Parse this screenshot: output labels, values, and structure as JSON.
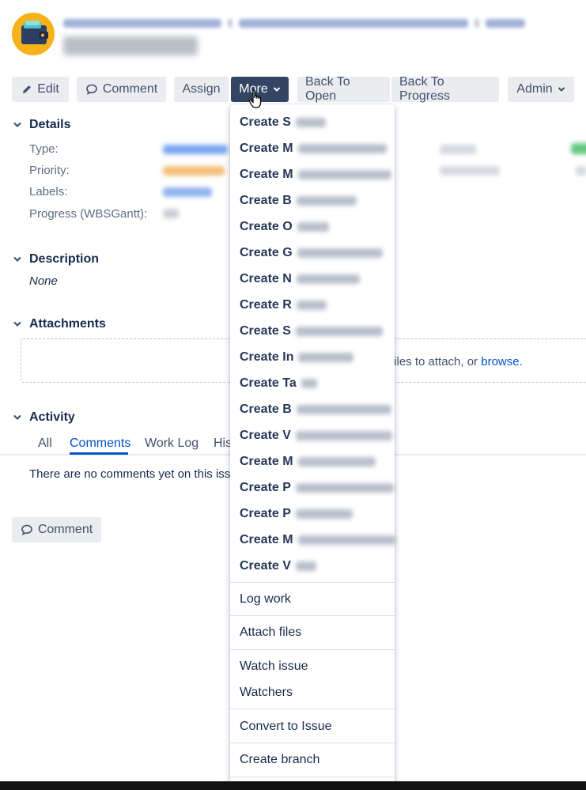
{
  "toolbar": {
    "edit_label": "Edit",
    "comment_label": "Comment",
    "assign_label": "Assign",
    "more_label": "More",
    "back_to_open_label": "Back To Open",
    "back_to_progress_label": "Back To Progress",
    "admin_label": "Admin"
  },
  "details": {
    "title": "Details",
    "fields": [
      {
        "label": "Type:"
      },
      {
        "label": "Priority:"
      },
      {
        "label": "Labels:"
      },
      {
        "label": "Progress (WBSGantt):"
      }
    ]
  },
  "description": {
    "title": "Description",
    "value": "None"
  },
  "attachments": {
    "title": "Attachments",
    "drop_text": "files to attach, or ",
    "browse_link": "browse."
  },
  "activity": {
    "title": "Activity",
    "tabs": [
      {
        "label": "All"
      },
      {
        "label": "Comments"
      },
      {
        "label": "Work Log"
      },
      {
        "label": "His"
      }
    ],
    "empty_text": "There are no comments yet on this iss"
  },
  "comment_button_label": "Comment",
  "more_menu": {
    "create_items": [
      "Create S",
      "Create M",
      "Create M",
      "Create B",
      "Create O",
      "Create G",
      "Create N",
      "Create R",
      "Create S",
      "Create In",
      "Create Ta",
      "Create B",
      "Create V",
      "Create M",
      "Create P",
      "Create P",
      "Create M",
      "Create V"
    ],
    "log_work": "Log work",
    "attach_files": "Attach files",
    "watch_issue": "Watch issue",
    "watchers": "Watchers",
    "convert_to_issue": "Convert to Issue",
    "create_branch": "Create branch"
  },
  "colors": {
    "more_button_bg": "#344563",
    "link_blue": "#0052cc",
    "avatar_orange": "#f6b21b",
    "button_gray": "#ebecf0"
  }
}
